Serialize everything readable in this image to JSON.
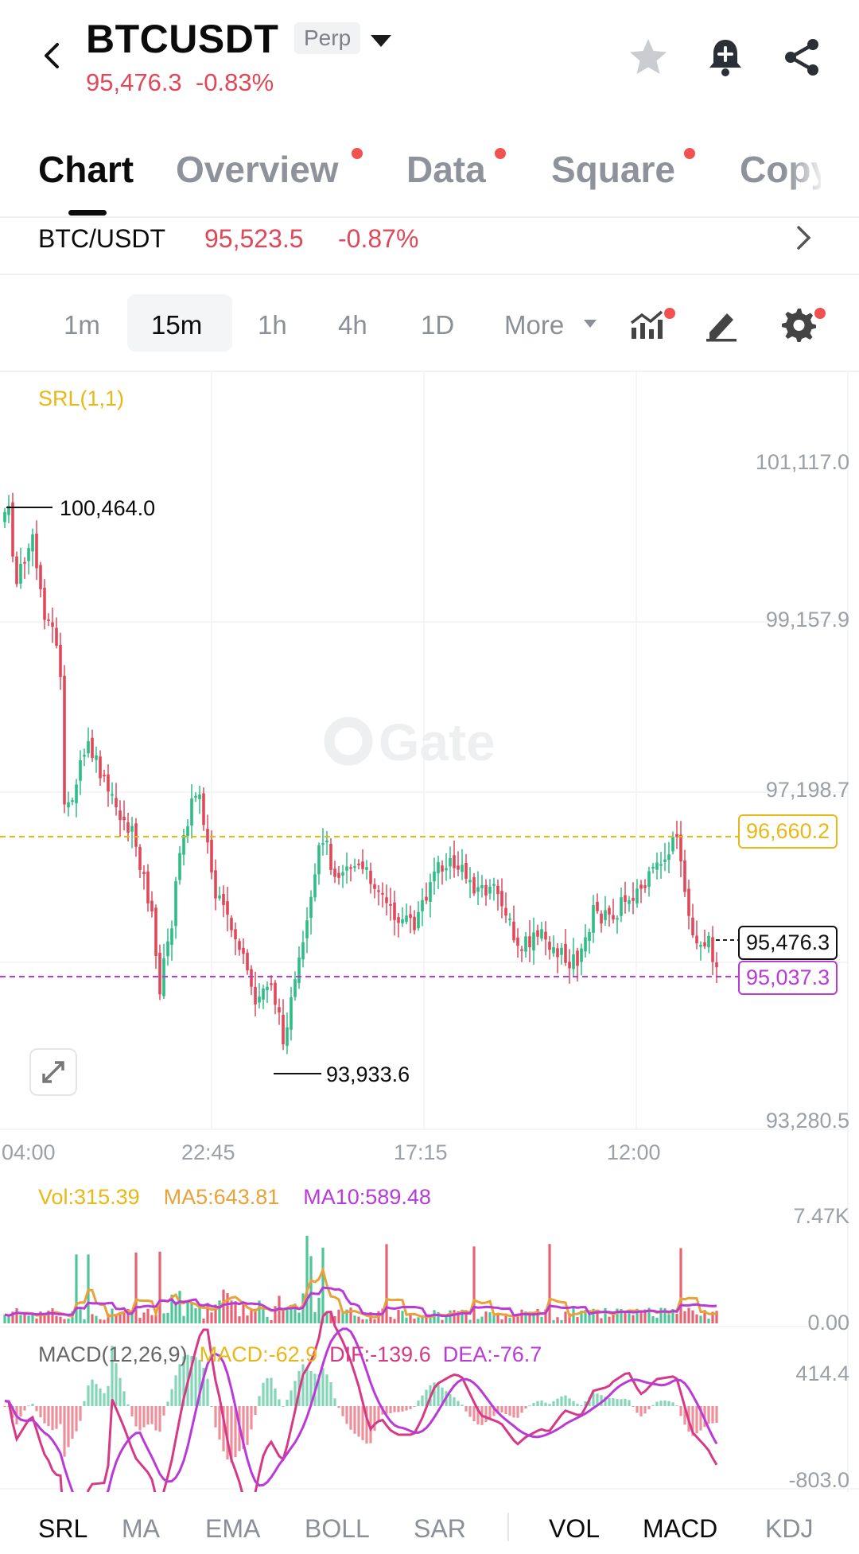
{
  "header": {
    "symbol": "BTCUSDT",
    "contract_type": "Perp",
    "price": "95,476.3",
    "change": "-0.83%",
    "icons": [
      "back-arrow-icon",
      "star-icon",
      "bell-plus-icon",
      "share-icon"
    ]
  },
  "tabs": [
    {
      "label": "Chart",
      "active": true
    },
    {
      "label": "Overview",
      "dot": true
    },
    {
      "label": "Data",
      "dot": true
    },
    {
      "label": "Square",
      "dot": true
    },
    {
      "label": "Copy"
    }
  ],
  "ticker": {
    "pair": "BTC/USDT",
    "price": "95,523.5",
    "change": "-0.87%"
  },
  "intervals": [
    "1m",
    "15m",
    "1h",
    "4h",
    "1D"
  ],
  "selected_interval": "15m",
  "more_label": "More",
  "toolbar_icons": [
    "indicator-icon",
    "draw-icon",
    "settings-icon"
  ],
  "chart": {
    "indicator_label": "SRL(1,1)",
    "watermark": "Gate",
    "y_labels": [
      "101,117.0",
      "99,157.9",
      "97,198.7",
      "93,280.5"
    ],
    "x_labels": [
      "04:00",
      "22:45",
      "17:15",
      "12:00"
    ],
    "high_label": "100,464.0",
    "low_label": "93,933.6",
    "srl_upper": "96,660.2",
    "last_price": "95,476.3",
    "srl_lower": "95,037.3",
    "colors": {
      "up": "#2ebd85",
      "down": "#e0485a",
      "srl_upper": "#e8b817",
      "srl_lower": "#b93ad6"
    }
  },
  "volume": {
    "vol": "Vol:315.39",
    "ma5": "MA5:643.81",
    "ma10": "MA10:589.48",
    "y_top": "7.47K",
    "y_bottom": "0.00"
  },
  "macd": {
    "label": "MACD(12,26,9)",
    "macd": "MACD:-62.9",
    "dif": "DIF:-139.6",
    "dea": "DEA:-76.7",
    "y_top": "414.4",
    "y_bottom": "-803.0"
  },
  "bottom_tabs": {
    "main": [
      "SRL",
      "MA",
      "EMA",
      "BOLL",
      "SAR"
    ],
    "sub": [
      "VOL",
      "MACD",
      "KDJ"
    ],
    "active": [
      "SRL",
      "VOL",
      "MACD"
    ]
  }
}
